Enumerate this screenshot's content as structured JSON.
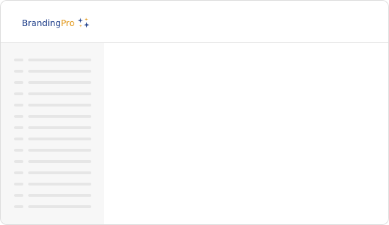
{
  "brand": {
    "name_part1": "Branding",
    "name_part2": "Pro",
    "colors": {
      "primary": "#1f3f8a",
      "accent": "#e39b20"
    },
    "logo_icon": "sparkles-icon"
  },
  "sidebar": {
    "placeholder_row_count": 14,
    "placeholder_color": "#e6e6e6",
    "background_color": "#f7f7f7"
  }
}
